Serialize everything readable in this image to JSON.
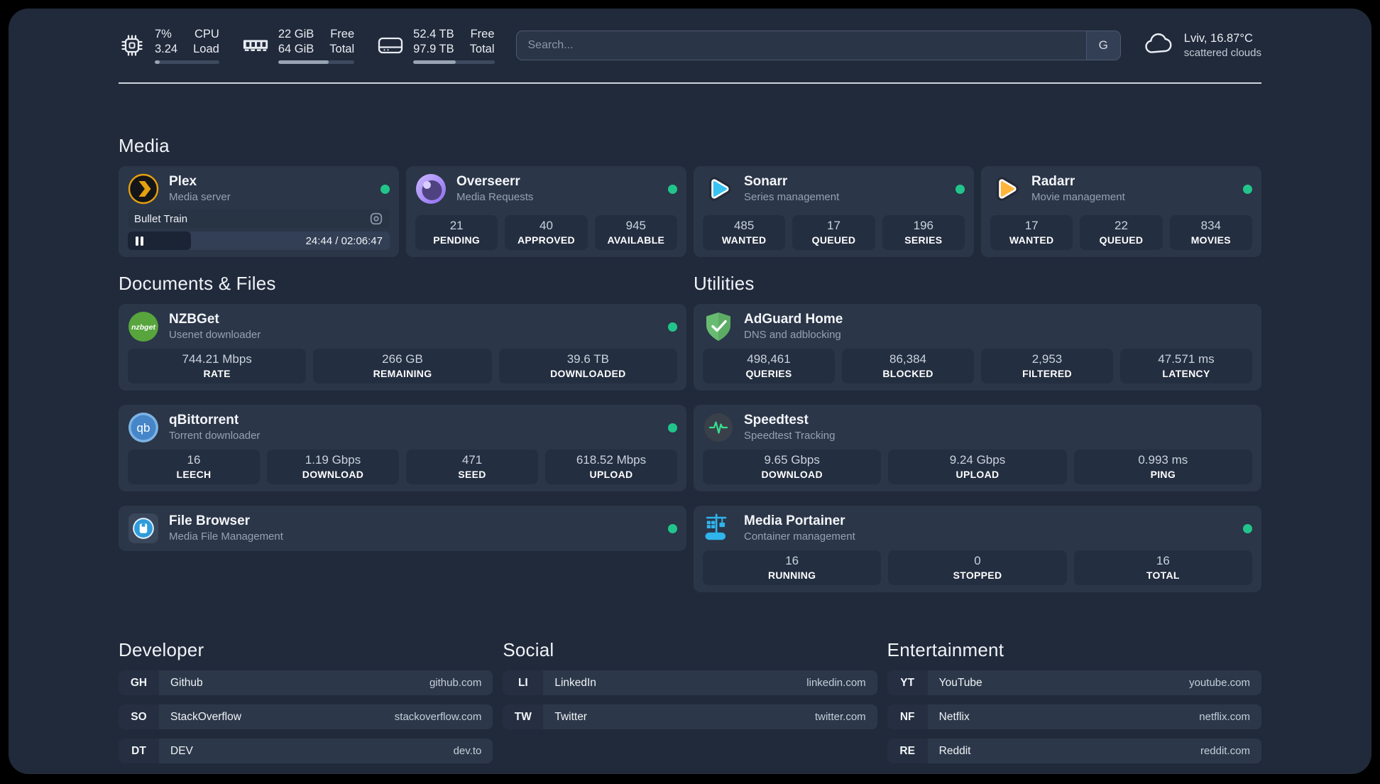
{
  "colors": {
    "background": "#212A3A",
    "card": "#2B3648",
    "stat_box": "#232E40",
    "status_green": "#21C58B",
    "divider": "#DDE3EC",
    "plex_gold": "#E5A00D",
    "overseerr_purple": "#8F6BF2",
    "sonarr_cyan": "#38C3F1",
    "radarr_orange": "#FFB53C",
    "nzbget_green": "#57A53C",
    "qbittorrent_blue": "#4E92D3",
    "adguard_green": "#68BC71",
    "speedtest_green": "#35E08E",
    "filebrowser_blue": "#2D9CDB",
    "portainer_blue": "#2FB4EC"
  },
  "topbar": {
    "stats": [
      {
        "value1": "7%",
        "label1": "CPU",
        "value2": "3.24",
        "label2": "Load",
        "progress": 8
      },
      {
        "value1": "22 GiB",
        "label1": "Free",
        "value2": "64 GiB",
        "label2": "Total",
        "progress": 66
      },
      {
        "value1": "52.4 TB",
        "label1": "Free",
        "value2": "97.9 TB",
        "label2": "Total",
        "progress": 52
      }
    ],
    "search": {
      "placeholder": "Search...",
      "engine": "G"
    },
    "weather": {
      "location": "Lviv, 16.87°C",
      "condition": "scattered clouds"
    }
  },
  "media": {
    "title": "Media",
    "plex": {
      "name": "Plex",
      "desc": "Media server",
      "now_playing": "Bullet Train",
      "time": "24:44 / 02:06:47",
      "progress": 24
    },
    "overseerr": {
      "name": "Overseerr",
      "desc": "Media Requests",
      "stats": [
        {
          "value": "21",
          "label": "PENDING"
        },
        {
          "value": "40",
          "label": "APPROVED"
        },
        {
          "value": "945",
          "label": "AVAILABLE"
        }
      ]
    },
    "sonarr": {
      "name": "Sonarr",
      "desc": "Series management",
      "stats": [
        {
          "value": "485",
          "label": "WANTED"
        },
        {
          "value": "17",
          "label": "QUEUED"
        },
        {
          "value": "196",
          "label": "SERIES"
        }
      ]
    },
    "radarr": {
      "name": "Radarr",
      "desc": "Movie management",
      "stats": [
        {
          "value": "17",
          "label": "WANTED"
        },
        {
          "value": "22",
          "label": "QUEUED"
        },
        {
          "value": "834",
          "label": "MOVIES"
        }
      ]
    }
  },
  "documents": {
    "title": "Documents & Files",
    "nzbget": {
      "name": "NZBGet",
      "desc": "Usenet downloader",
      "stats": [
        {
          "value": "744.21 Mbps",
          "label": "RATE"
        },
        {
          "value": "266 GB",
          "label": "REMAINING"
        },
        {
          "value": "39.6 TB",
          "label": "DOWNLOADED"
        }
      ]
    },
    "qbittorrent": {
      "name": "qBittorrent",
      "desc": "Torrent downloader",
      "stats": [
        {
          "value": "16",
          "label": "LEECH"
        },
        {
          "value": "1.19 Gbps",
          "label": "DOWNLOAD"
        },
        {
          "value": "471",
          "label": "SEED"
        },
        {
          "value": "618.52 Mbps",
          "label": "UPLOAD"
        }
      ]
    },
    "filebrowser": {
      "name": "File Browser",
      "desc": "Media File Management"
    }
  },
  "utilities": {
    "title": "Utilities",
    "adguard": {
      "name": "AdGuard Home",
      "desc": "DNS and adblocking",
      "stats": [
        {
          "value": "498,461",
          "label": "QUERIES"
        },
        {
          "value": "86,384",
          "label": "BLOCKED"
        },
        {
          "value": "2,953",
          "label": "FILTERED"
        },
        {
          "value": "47.571 ms",
          "label": "LATENCY"
        }
      ]
    },
    "speedtest": {
      "name": "Speedtest",
      "desc": "Speedtest Tracking",
      "stats": [
        {
          "value": "9.65 Gbps",
          "label": "DOWNLOAD"
        },
        {
          "value": "9.24 Gbps",
          "label": "UPLOAD"
        },
        {
          "value": "0.993 ms",
          "label": "PING"
        }
      ]
    },
    "portainer": {
      "name": "Media Portainer",
      "desc": "Container management",
      "stats": [
        {
          "value": "16",
          "label": "RUNNING"
        },
        {
          "value": "0",
          "label": "STOPPED"
        },
        {
          "value": "16",
          "label": "TOTAL"
        }
      ]
    }
  },
  "bookmarks": [
    {
      "title": "Developer",
      "items": [
        {
          "tag": "GH",
          "name": "Github",
          "url": "github.com"
        },
        {
          "tag": "SO",
          "name": "StackOverflow",
          "url": "stackoverflow.com"
        },
        {
          "tag": "DT",
          "name": "DEV",
          "url": "dev.to"
        }
      ]
    },
    {
      "title": "Social",
      "items": [
        {
          "tag": "LI",
          "name": "LinkedIn",
          "url": "linkedin.com"
        },
        {
          "tag": "TW",
          "name": "Twitter",
          "url": "twitter.com"
        }
      ]
    },
    {
      "title": "Entertainment",
      "items": [
        {
          "tag": "YT",
          "name": "YouTube",
          "url": "youtube.com"
        },
        {
          "tag": "NF",
          "name": "Netflix",
          "url": "netflix.com"
        },
        {
          "tag": "RE",
          "name": "Reddit",
          "url": "reddit.com"
        }
      ]
    }
  ]
}
